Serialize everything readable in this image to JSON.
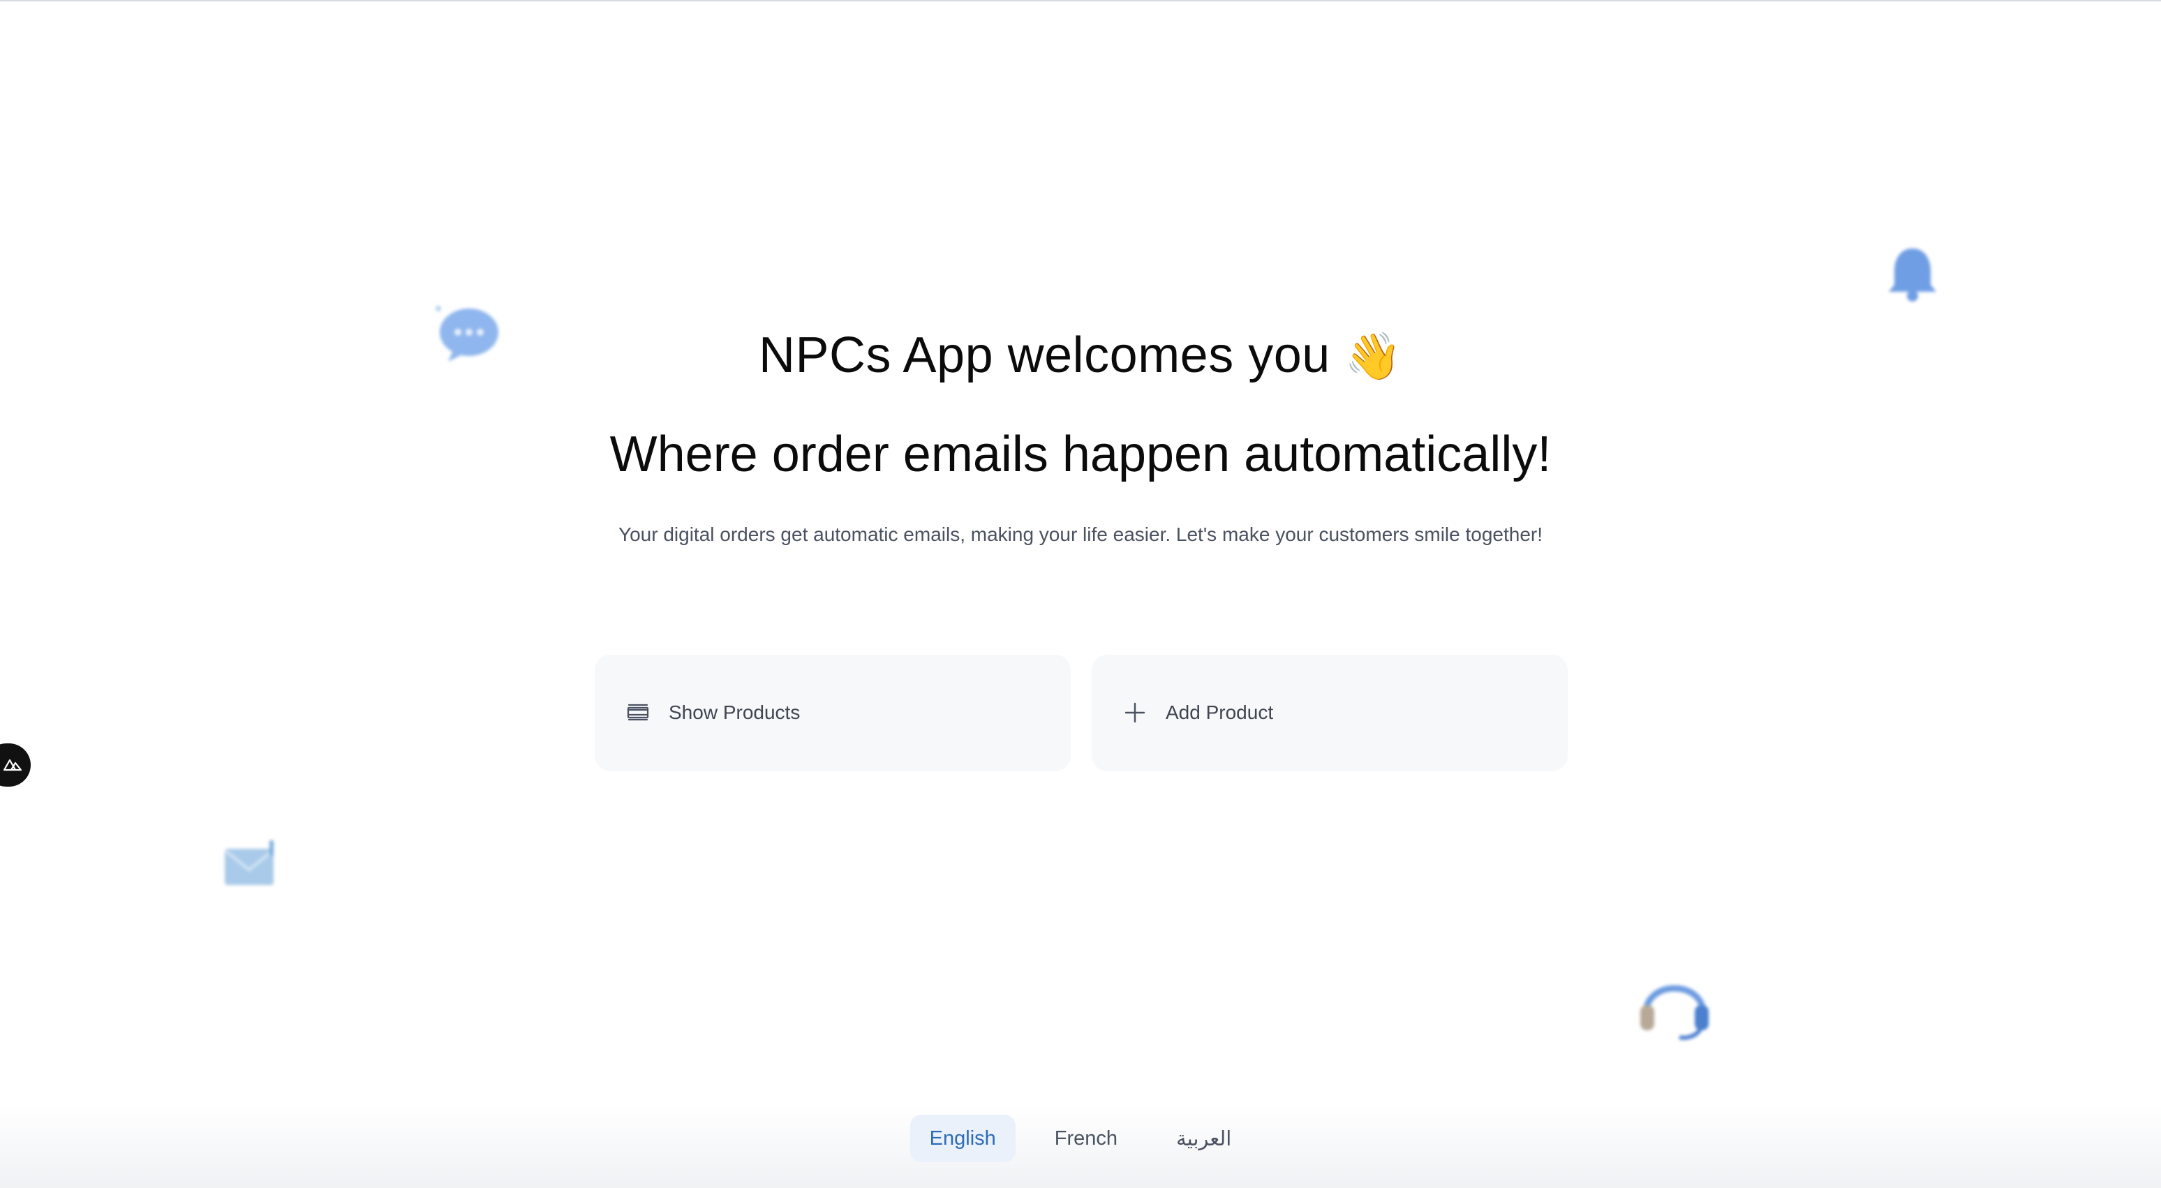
{
  "hero": {
    "title": "NPCs App welcomes you",
    "title_emoji": "👋",
    "subtitle": "Where order emails happen automatically!",
    "description": "Your digital orders get automatic emails, making your life easier. Let's make your customers smile together!"
  },
  "actions": [
    {
      "label": "Show Products",
      "icon": "list-icon"
    },
    {
      "label": "Add Product",
      "icon": "plus-icon"
    }
  ],
  "languages": {
    "items": [
      "English",
      "French",
      "العربية"
    ],
    "selected": "English"
  },
  "decorations": {
    "icons": [
      "chat-bubble-icon",
      "bell-icon",
      "mail-icon",
      "headphones-icon"
    ],
    "accent_color": "#7fa8e8"
  },
  "side_badge": {
    "icon": "nuxt-logo-icon"
  },
  "colors": {
    "active_language_bg": "#eaf1fb",
    "active_language_text": "#2d6cb5",
    "card_bg": "#f7f8fa",
    "body_text": "#4a5160"
  }
}
